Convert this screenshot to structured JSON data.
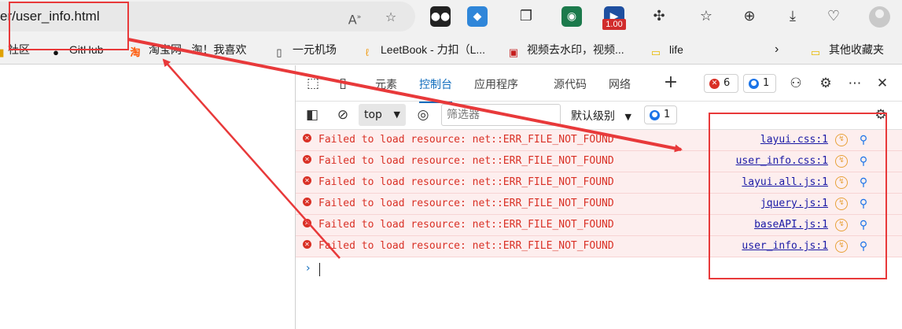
{
  "browser": {
    "address_text": "er/user_info.html",
    "update_badge": "1.00",
    "icons": [
      "read-aloud-icon",
      "add-favorite-icon",
      "extension-icons",
      "favorites-icon",
      "collections-icon",
      "downloads-icon",
      "health-icon",
      "profile-icon"
    ]
  },
  "bookmarks": [
    {
      "label": "社区",
      "icon": "community-icon"
    },
    {
      "label": "GitHub",
      "icon": "github-icon"
    },
    {
      "label": "淘宝网 - 淘！我喜欢",
      "icon": "taobao-icon"
    },
    {
      "label": "一元机场",
      "icon": "page-icon"
    },
    {
      "label": "LeetBook - 力扣（L...",
      "icon": "leetcode-icon"
    },
    {
      "label": "视频去水印，视频...",
      "icon": "video-icon"
    },
    {
      "label": "life",
      "icon": "folder-icon"
    },
    {
      "label": "其他收藏夹",
      "icon": "folder-icon"
    }
  ],
  "devtools": {
    "tabs": [
      "元素",
      "控制台",
      "应用程序",
      "源代码",
      "网络"
    ],
    "active_tab": "控制台",
    "error_count": "6",
    "message_count": "1",
    "context": "top",
    "filter_placeholder": "筛选器",
    "levels_label": "默认级别",
    "toolbar_message_count": "1"
  },
  "console_rows": [
    {
      "message": "Failed to load resource: net::ERR_FILE_NOT_FOUND",
      "source": "layui.css:1"
    },
    {
      "message": "Failed to load resource: net::ERR_FILE_NOT_FOUND",
      "source": "user_info.css:1"
    },
    {
      "message": "Failed to load resource: net::ERR_FILE_NOT_FOUND",
      "source": "layui.all.js:1"
    },
    {
      "message": "Failed to load resource: net::ERR_FILE_NOT_FOUND",
      "source": "jquery.js:1"
    },
    {
      "message": "Failed to load resource: net::ERR_FILE_NOT_FOUND",
      "source": "baseAPI.js:1"
    },
    {
      "message": "Failed to load resource: net::ERR_FILE_NOT_FOUND",
      "source": "user_info.js:1"
    }
  ],
  "colors": {
    "annotation": "#e8393a",
    "error_text": "#d93025",
    "error_bg": "#fdeeee",
    "link": "#1a1aa6",
    "accent": "#0f6cbd"
  }
}
